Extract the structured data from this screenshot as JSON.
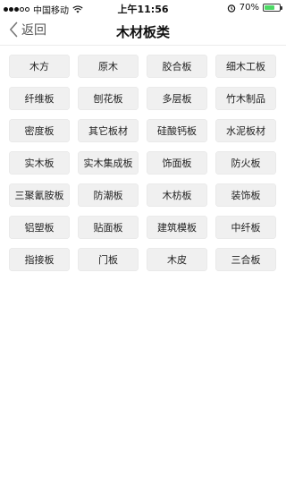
{
  "status_bar": {
    "carrier": "中国移动",
    "time": "上午11:56",
    "battery_percent": "70%",
    "battery_level": 0.7,
    "icons": [
      "signal-icon",
      "wifi-icon",
      "alarm-icon",
      "battery-icon"
    ]
  },
  "nav": {
    "back_label": "返回",
    "title": "木材板类"
  },
  "categories": [
    "木方",
    "原木",
    "胶合板",
    "细木工板",
    "纤维板",
    "刨花板",
    "多层板",
    "竹木制品",
    "密度板",
    "其它板材",
    "硅酸钙板",
    "水泥板材",
    "实木板",
    "实木集成板",
    "饰面板",
    "防火板",
    "三聚氰胺板",
    "防潮板",
    "木枋板",
    "装饰板",
    "铝塑板",
    "贴面板",
    "建筑模板",
    "中纤板",
    "指接板",
    "门板",
    "木皮",
    "三合板"
  ],
  "colors": {
    "cell_bg": "#f0f0f0",
    "battery_green": "#4cd964"
  }
}
